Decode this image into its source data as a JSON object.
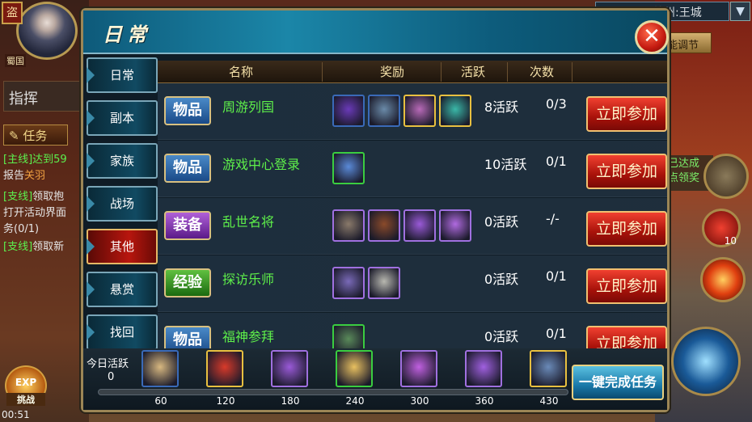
{
  "hud": {
    "crest": "盗",
    "country": "蜀国",
    "command": "指挥",
    "task_btn": "任务",
    "quests": [
      {
        "tag": "[主线]",
        "text": "达到59",
        "line2_prefix": "报告",
        "line2_highlight": "关羽"
      },
      {
        "tag": "[支线]",
        "text": "领取抱",
        "line2": "打开活动界面",
        "line3": "务(0/1)"
      },
      {
        "tag": "[支线]",
        "text": "领取新"
      }
    ],
    "clock": "00:51",
    "exp_label": "EXP",
    "exp_sub": "挑战",
    "city": "美州:王城",
    "festival": "能调节",
    "right_reward": [
      "已达成",
      "点领奖"
    ],
    "skill_count": "10"
  },
  "panel": {
    "title": "日常",
    "close": "✕",
    "tabs": [
      "日常",
      "副本",
      "家族",
      "战场",
      "其他",
      "悬赏",
      "找回"
    ],
    "active_tab": "其他",
    "headers": {
      "name": "名称",
      "reward": "奖励",
      "active": "活跃",
      "count": "次数"
    },
    "rows": [
      {
        "category": "物品",
        "name": "周游列国",
        "active": "8活跃",
        "count": "0/3",
        "join": "立即参加",
        "items": [
          {
            "icon": "purple-orb",
            "color": "#6a3ab8",
            "frame": "blue"
          },
          {
            "icon": "crystal-cube",
            "color": "#6a8aa8",
            "frame": "blue"
          },
          {
            "icon": "scroll",
            "color": "#b86ab8",
            "frame": "gold"
          },
          {
            "icon": "teal-scroll",
            "color": "#3ab8a8",
            "frame": "gold"
          }
        ]
      },
      {
        "category": "物品",
        "name": "游戏中心登录",
        "active": "10活跃",
        "count": "0/1",
        "join": "立即参加",
        "items": [
          {
            "icon": "gift-box",
            "color": "#5a8ad8",
            "frame": "green"
          }
        ]
      },
      {
        "category": "装备",
        "name": "乱世名将",
        "active": "0活跃",
        "count": "-/-",
        "join": "立即参加",
        "items": [
          {
            "icon": "general-figure",
            "color": "#8a7a6a",
            "frame": "purple"
          },
          {
            "icon": "saddle",
            "color": "#8a4a2a",
            "frame": "purple"
          },
          {
            "icon": "purple-crystal",
            "color": "#9a5ad8",
            "frame": "purple"
          },
          {
            "icon": "purple-shard",
            "color": "#b06ae0",
            "frame": "purple"
          }
        ]
      },
      {
        "category": "经验",
        "name": "探访乐师",
        "active": "0活跃",
        "count": "0/1",
        "join": "立即参加",
        "items": [
          {
            "icon": "exp-token",
            "color": "#7a6ab8",
            "frame": "purple"
          },
          {
            "icon": "silver-coin",
            "color": "#b8b8b0",
            "frame": "purple"
          }
        ]
      },
      {
        "category": "物品",
        "name": "福神参拜",
        "active": "0活跃",
        "count": "0/1",
        "join": "立即参加",
        "items": [
          {
            "icon": "green-scroll",
            "color": "#5a8a5a",
            "frame": "green"
          }
        ]
      }
    ],
    "bottom": {
      "label": "今日活跃",
      "value": "0",
      "progress": 0,
      "quick_button": "一键完成任务",
      "milestones": [
        {
          "points": "60",
          "icon": "scroll-chest",
          "color": "#d8b880",
          "frame": "blue"
        },
        {
          "points": "120",
          "icon": "red-gift",
          "color": "#d83a2a",
          "frame": "gold"
        },
        {
          "points": "180",
          "icon": "purple-crystal",
          "color": "#9a5ad8",
          "frame": "purple"
        },
        {
          "points": "240",
          "icon": "gold-scroll",
          "color": "#e8c060",
          "frame": "green"
        },
        {
          "points": "300",
          "icon": "pink-shard",
          "color": "#c060e0",
          "frame": "purple"
        },
        {
          "points": "360",
          "icon": "purple-gem",
          "color": "#a060e0",
          "frame": "purple"
        },
        {
          "points": "430",
          "icon": "armor-set",
          "color": "#6a8ab8",
          "frame": "gold"
        }
      ]
    }
  }
}
